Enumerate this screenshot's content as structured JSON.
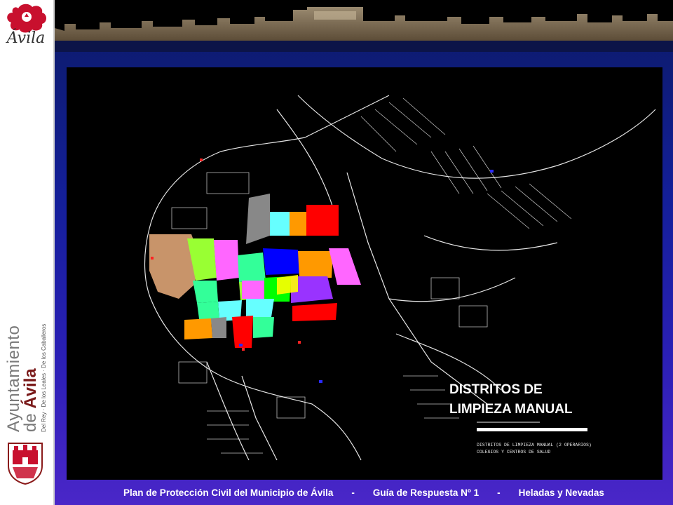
{
  "sidebar": {
    "logo_text": "Ávila",
    "vertical_title": "Ayuntamiento",
    "vertical_title2_prefix": "de ",
    "vertical_title2_city": "Ávila",
    "vertical_tagline": "Del Rey · De los Leales · De los Caballeros"
  },
  "slide": {
    "map_title_line1": "DISTRITOS DE",
    "map_title_line2": "LIMPIEZA MANUAL",
    "legend_line1": "DISTRITOS DE LIMPIEZA MANUAL (2 OPERARIOS)",
    "legend_line2": "COLEGIOS Y CENTROS DE SALUD"
  },
  "footer": {
    "part1": "Plan de Protección Civil del Municipio de Ávila",
    "sep1": "-",
    "part2": "Guía de Respuesta Nº 1",
    "sep2": "-",
    "part3": "Heladas y Nevadas"
  },
  "colors": {
    "background_top": "#0b1a66",
    "background_bottom": "#4a26c8",
    "logo_red": "#c8102e",
    "map_background": "#000000",
    "district_colors": [
      "#c8946a",
      "#99ff33",
      "#ff66ff",
      "#33ff99",
      "#0000ff",
      "#ff0000",
      "#66ffff",
      "#ff9900",
      "#888888",
      "#00ff00",
      "#9933ff",
      "#ff3366"
    ]
  }
}
